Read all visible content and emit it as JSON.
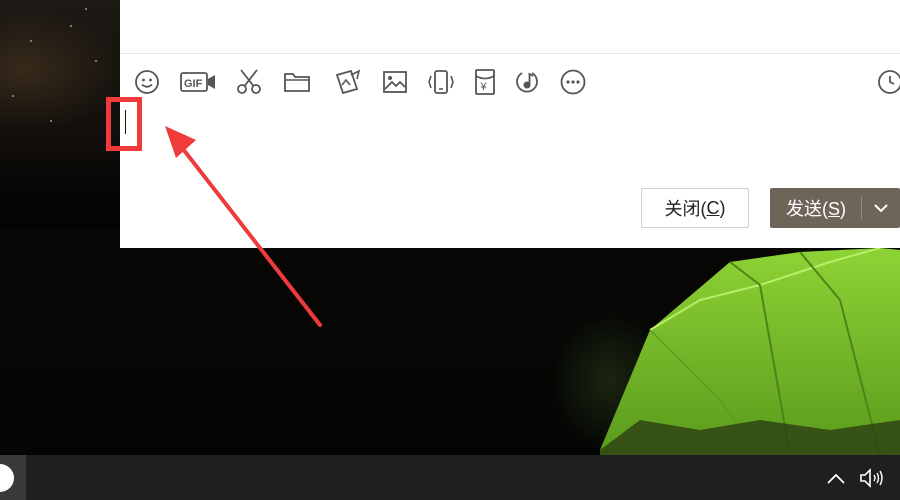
{
  "chat": {
    "toolbar": [
      {
        "name": "emoji-icon",
        "tooltip": ""
      },
      {
        "name": "gif-icon",
        "text": "GIF"
      },
      {
        "name": "scissors-icon"
      },
      {
        "name": "folder-icon"
      },
      {
        "name": "image-edit-icon"
      },
      {
        "name": "image-icon"
      },
      {
        "name": "shake-icon"
      },
      {
        "name": "red-packet-icon",
        "text": "¥"
      },
      {
        "name": "music-icon"
      },
      {
        "name": "more-icon"
      },
      {
        "name": "history-icon"
      }
    ],
    "input_value": "",
    "close_label": "关闭(",
    "close_key": "C",
    "close_suffix": ")",
    "send_label": "发送(",
    "send_key": "S",
    "send_suffix": ")"
  },
  "colors": {
    "send_button": "#6e6457",
    "annotation": "#ef3b3b",
    "tent": "#7ec62c",
    "taskbar": "#1f1f1f"
  }
}
